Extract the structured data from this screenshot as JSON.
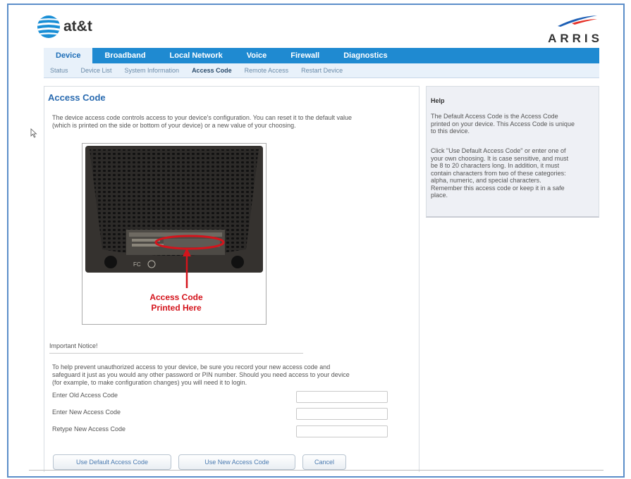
{
  "brand": {
    "att": "at&t",
    "arris": "ARRIS"
  },
  "nav": {
    "tabs": [
      {
        "label": "Device",
        "active": true
      },
      {
        "label": "Broadband",
        "active": false
      },
      {
        "label": "Local Network",
        "active": false
      },
      {
        "label": "Voice",
        "active": false
      },
      {
        "label": "Firewall",
        "active": false
      },
      {
        "label": "Diagnostics",
        "active": false
      }
    ],
    "subtabs": [
      {
        "label": "Status",
        "active": false
      },
      {
        "label": "Device List",
        "active": false
      },
      {
        "label": "System Information",
        "active": false
      },
      {
        "label": "Access Code",
        "active": true
      },
      {
        "label": "Remote Access",
        "active": false
      },
      {
        "label": "Restart Device",
        "active": false
      }
    ]
  },
  "main": {
    "title": "Access Code",
    "description_line1": "The device access code controls access to your device's configuration. You can reset it to the default value",
    "description_line2": "(which is printed on the side or bottom of your device) or a new value of your choosing.",
    "photo_caption_line1": "Access Code",
    "photo_caption_line2": "Printed Here",
    "notice_heading": "Important Notice!",
    "notice_line1": "To help prevent unauthorized access to your device, be sure you record your new access code and",
    "notice_line2": "safeguard it just as you would any other password or PIN number. Should you need access to your device",
    "notice_line3": "(for example, to make configuration changes) you will need it to login.",
    "fields": {
      "old_label": "Enter Old Access Code",
      "old_value": "",
      "new_label": "Enter New Access Code",
      "new_value": "",
      "retype_label": "Retype New Access Code",
      "retype_value": ""
    },
    "buttons": {
      "default": "Use Default Access Code",
      "new": "Use New Access Code",
      "cancel": "Cancel"
    }
  },
  "help": {
    "title": "Help",
    "p1_lines": [
      "The Default Access Code is the Access Code",
      "printed on your device. This Access Code is unique",
      "to this device."
    ],
    "p2_lines": [
      "Click \"Use Default Access Code\" or enter one of",
      "your own choosing. It is case sensitive, and must",
      "be 8 to 20 characters long. In addition, it must",
      "contain characters from two of these categories:",
      "alpha, numeric, and special characters.",
      "Remember this access code or keep it in a safe",
      "place."
    ]
  },
  "colors": {
    "nav_blue": "#1f8ad1",
    "title_blue": "#2a6bb0",
    "frame_blue": "#5b8ec9",
    "caption_red": "#d4141c"
  }
}
